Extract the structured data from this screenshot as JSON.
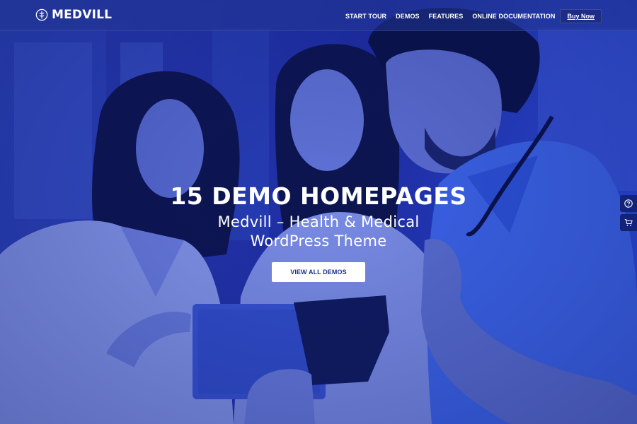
{
  "brand": {
    "name": "MEDVILL",
    "logo_icon": "medical-emblem-icon"
  },
  "nav": {
    "items": [
      {
        "label": "START TOUR"
      },
      {
        "label": "DEMOS"
      },
      {
        "label": "FEATURES"
      },
      {
        "label": "ONLINE DOCUMENTATION"
      }
    ],
    "buy_label": "Buy Now"
  },
  "hero": {
    "title": "15 DEMO HOMEPAGES",
    "subtitle_line1": "Medvill – Health & Medical",
    "subtitle_line2": "WordPress Theme",
    "cta_label": "VIEW ALL DEMOS"
  },
  "side_widgets": [
    {
      "icon": "help-icon"
    },
    {
      "icon": "cart-icon"
    }
  ],
  "colors": {
    "overlay_blue": "#2536b0",
    "nav_button": "#1d2d86",
    "cta_text": "#1f2f95",
    "side_widget": "#14237a"
  }
}
